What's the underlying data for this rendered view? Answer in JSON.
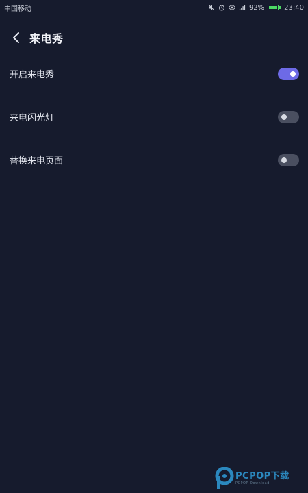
{
  "status_bar": {
    "carrier": "中国移动",
    "battery_percent": "92%",
    "battery_level": 0.92,
    "time": "23:40",
    "icons": [
      "mute-icon",
      "alarm-icon",
      "eye-icon",
      "signal-icon",
      "battery-icon"
    ]
  },
  "header": {
    "back_icon": "chevron-left-icon",
    "title": "来电秀"
  },
  "settings": [
    {
      "label": "开启来电秀",
      "enabled": true
    },
    {
      "label": "来电闪光灯",
      "enabled": false
    },
    {
      "label": "替换来电页面",
      "enabled": false
    }
  ],
  "colors": {
    "background": "#161b2d",
    "toggle_on": "#6d6ae6",
    "toggle_off": "#4a4f60",
    "battery": "#4cd964"
  },
  "watermark": {
    "brand": "PCPOP下载",
    "sub": "PCPOP Download"
  }
}
